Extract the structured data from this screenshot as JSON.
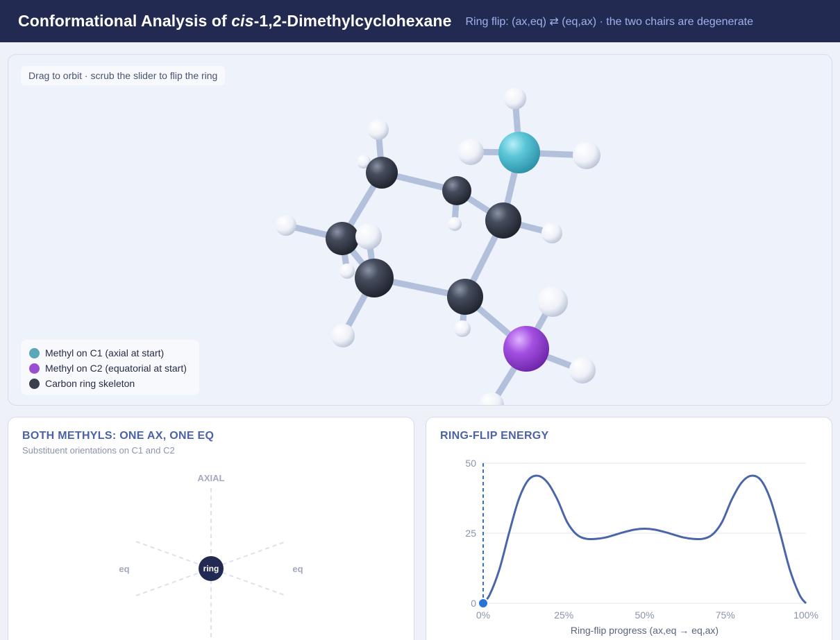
{
  "header": {
    "title_prefix": "Conformational Analysis of ",
    "title_italic": "cis",
    "title_suffix": "-1,2-Dimethylcyclohexane",
    "subtitle": "Ring flip: (ax,eq) ⇄ (eq,ax) · the two chairs are degenerate"
  },
  "viewer": {
    "hint": "Drag to orbit · scrub the slider to flip the ring",
    "legend": [
      {
        "label": "Methyl on C1 (axial at start)",
        "color": "#5aa7b8"
      },
      {
        "label": "Methyl on C2 (equatorial at start)",
        "color": "#9a4fd0"
      },
      {
        "label": "Carbon ring skeleton",
        "color": "#3a3f4b"
      }
    ],
    "colors": {
      "carbon": "#3a3f4b",
      "hydrogen": "#f4f6fb",
      "bond": "#b3c0dc",
      "methyl_c1": "#5ac3d6",
      "methyl_c2": "#a44fe0"
    }
  },
  "orientation_card": {
    "title": "BOTH METHYLS: ONE AX, ONE EQ",
    "subtitle": "Substituent orientations on C1 and C2",
    "axial_label": "AXIAL",
    "eq_left": "eq",
    "eq_right": "eq",
    "center_label": "ring"
  },
  "energy_card": {
    "title": "RING-FLIP ENERGY"
  },
  "chart_data": {
    "type": "line",
    "title": "RING-FLIP ENERGY",
    "xlabel": "Ring-flip progress (ax,eq → eq,ax)",
    "ylabel": "",
    "xlim": [
      0,
      100
    ],
    "ylim": [
      0,
      50
    ],
    "x_ticks": [
      "0%",
      "25%",
      "50%",
      "75%",
      "100%"
    ],
    "y_ticks": [
      "0",
      "25",
      "50"
    ],
    "grid": true,
    "series": [
      {
        "color": "#4a66a8",
        "x": [
          0,
          2,
          5,
          8,
          11,
          14,
          17,
          20,
          23,
          26,
          29,
          32,
          35,
          38,
          41,
          44,
          47,
          50,
          53,
          56,
          59,
          62,
          65,
          68,
          71,
          74,
          77,
          80,
          83,
          86,
          89,
          92,
          95,
          98,
          100
        ],
        "y": [
          0,
          3,
          12,
          25,
          37,
          44,
          45.5,
          43,
          37,
          29,
          24.5,
          23,
          23,
          23.5,
          24.5,
          25.5,
          26.3,
          26.6,
          26.3,
          25.5,
          24.5,
          23.5,
          23,
          23,
          24.5,
          29,
          37,
          43,
          45.5,
          44,
          37,
          25,
          12,
          3,
          0
        ]
      }
    ],
    "marker": {
      "x": 0,
      "y": 0,
      "color": "#2a74d6"
    }
  }
}
